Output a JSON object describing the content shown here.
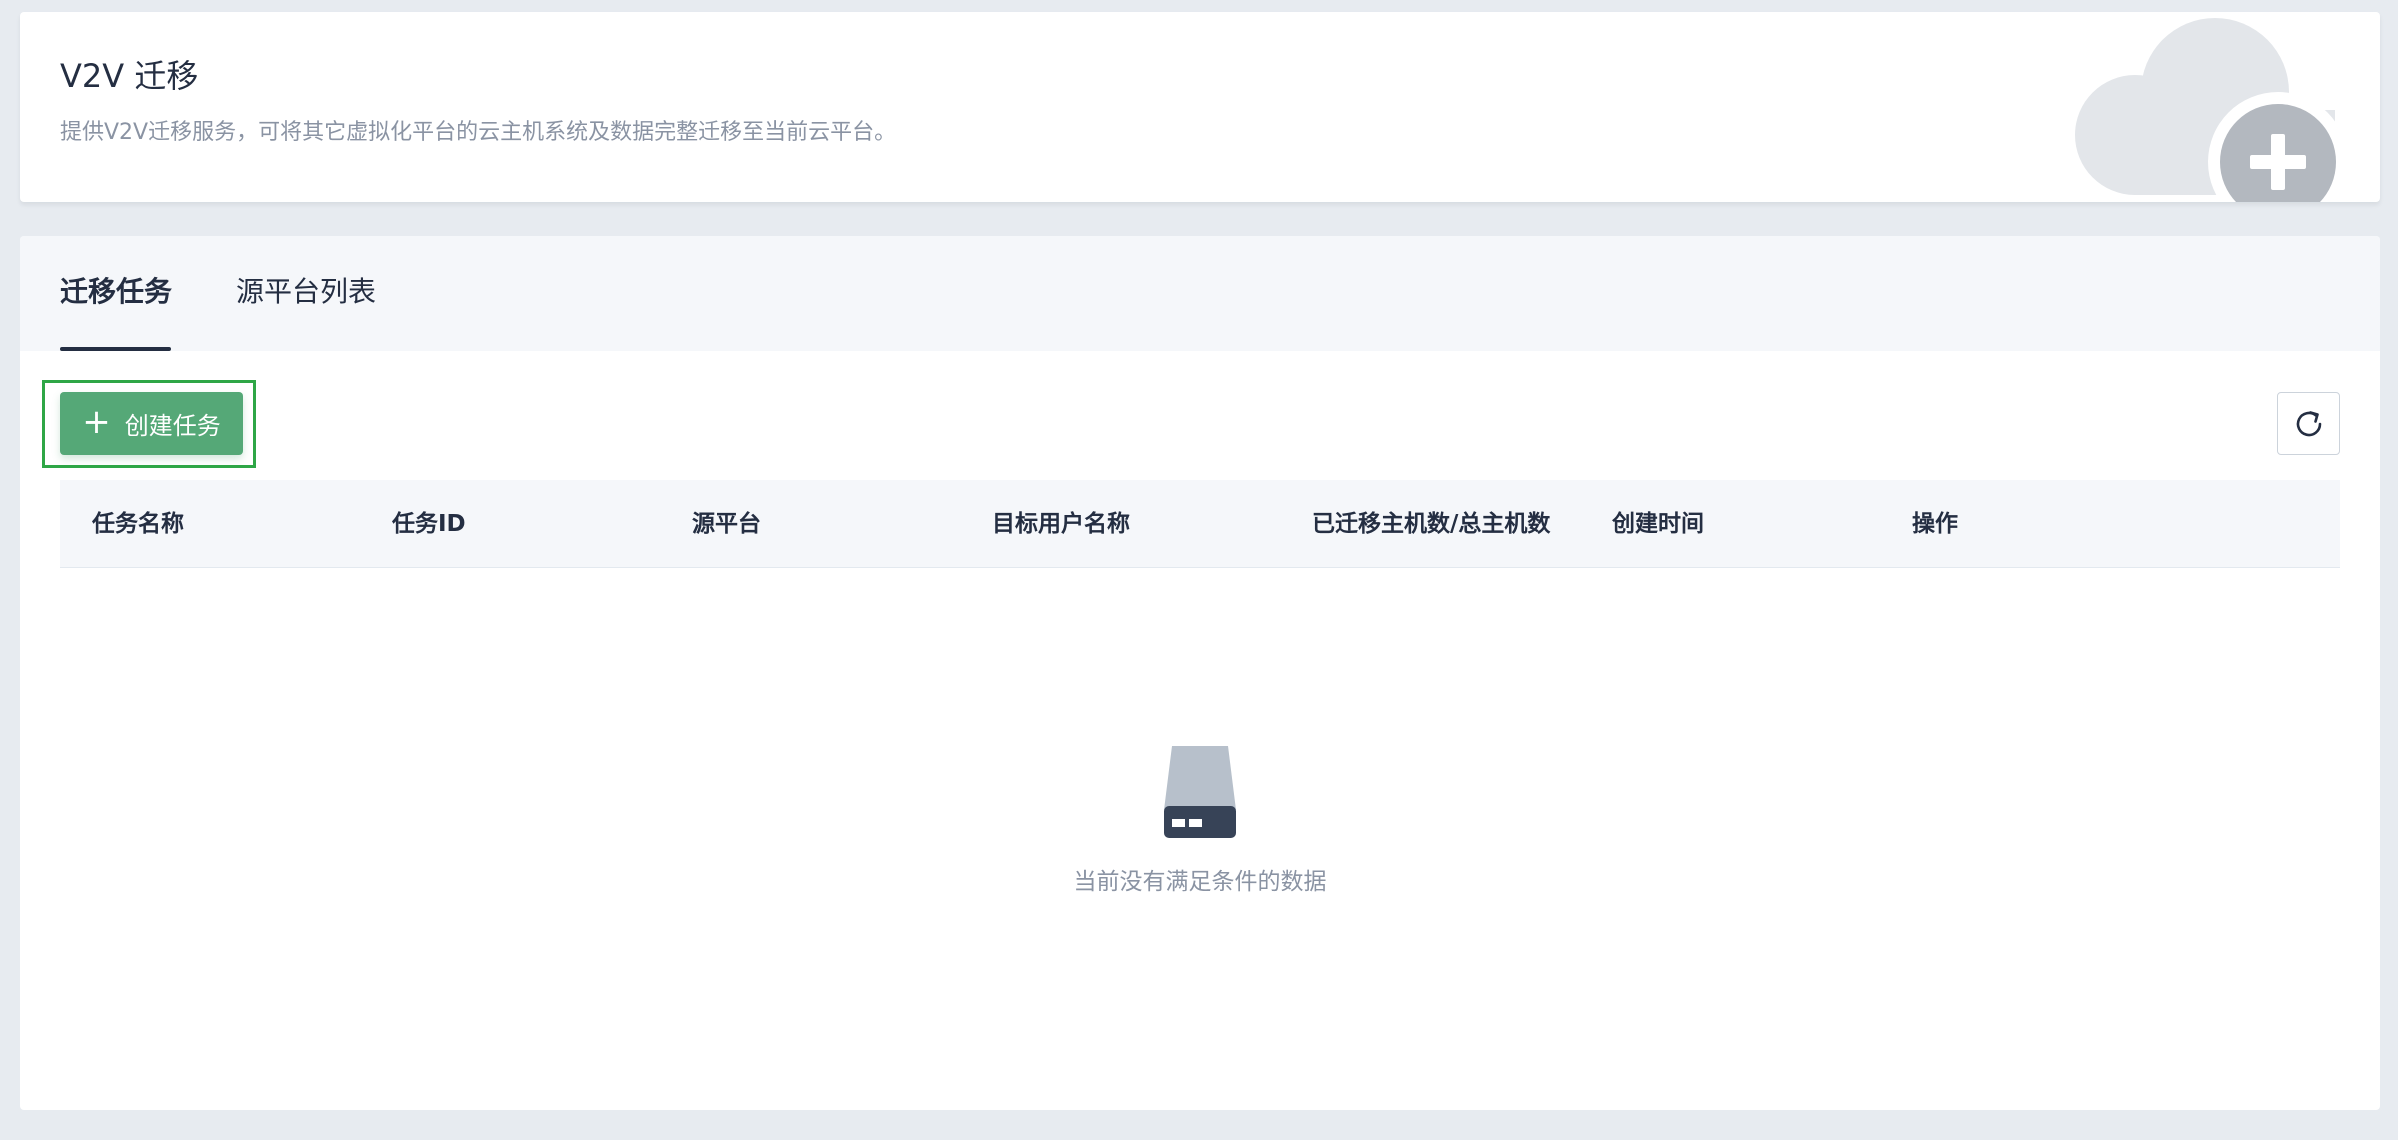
{
  "header": {
    "title": "V2V 迁移",
    "description": "提供V2V迁移服务，可将其它虚拟化平台的云主机系统及数据完整迁移至当前云平台。",
    "illustration": "cloud-add-icon"
  },
  "tabs": [
    {
      "label": "迁移任务",
      "active": true
    },
    {
      "label": "源平台列表",
      "active": false
    }
  ],
  "toolbar": {
    "create_label": "创建任务",
    "create_icon": "plus-icon",
    "refresh_icon": "refresh-icon"
  },
  "table": {
    "columns": [
      "任务名称",
      "任务ID",
      "源平台",
      "目标用户名称",
      "已迁移主机数/总主机数",
      "创建时间",
      "操作"
    ],
    "rows": []
  },
  "empty_state": {
    "icon": "empty-drive-icon",
    "text": "当前没有满足条件的数据"
  },
  "colors": {
    "primary": "#55a877",
    "highlight": "#2ea646",
    "text": "#242e42",
    "muted": "#8a93a3",
    "background": "#e7ebf0"
  }
}
